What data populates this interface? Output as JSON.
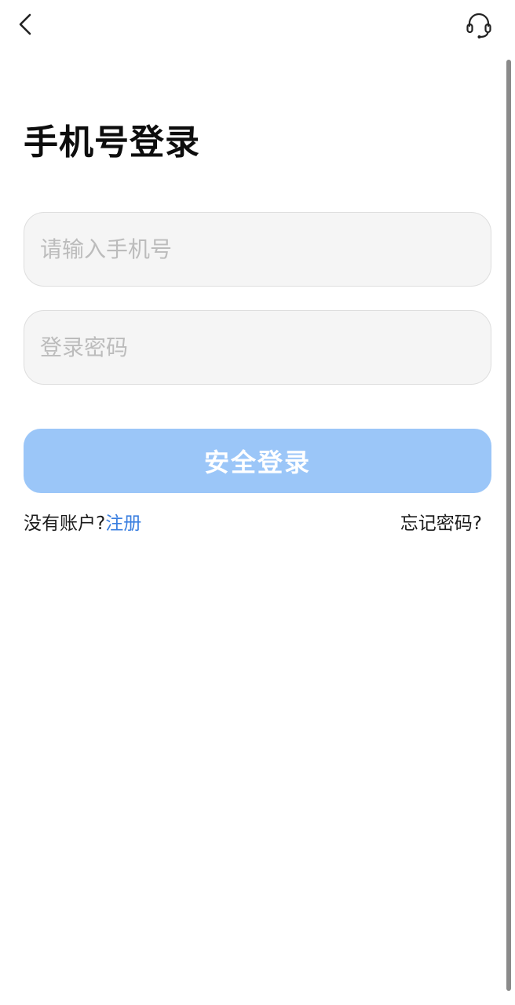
{
  "header": {
    "back_icon": "chevron-left-icon",
    "service_icon": "headset-icon"
  },
  "page": {
    "title": "手机号登录"
  },
  "form": {
    "phone_placeholder": "请输入手机号",
    "phone_value": "",
    "password_placeholder": "登录密码",
    "password_value": "",
    "submit_label": "安全登录"
  },
  "links": {
    "no_account_text": "没有账户?",
    "register_label": "注册",
    "forgot_label": "忘记密码?"
  },
  "colors": {
    "accent": "#3a7fe0",
    "button_bg": "#9bc6f8",
    "field_bg": "#f5f5f5"
  }
}
